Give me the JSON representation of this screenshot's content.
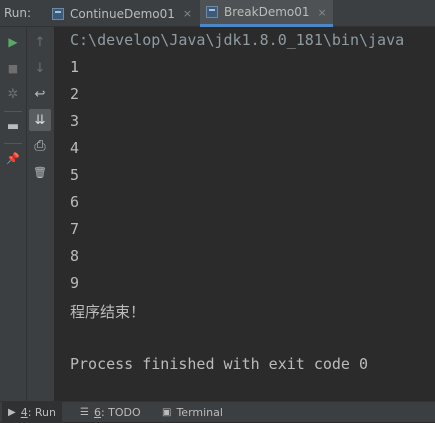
{
  "header": {
    "run_label": "Run:",
    "tabs": [
      {
        "label": "ContinueDemo01",
        "active": false
      },
      {
        "label": "BreakDemo01",
        "active": true
      }
    ],
    "close_glyph": "×"
  },
  "toolbar": {
    "left": [
      {
        "icon": "play-icon",
        "glyph": "▶",
        "color": "#59a869"
      },
      {
        "icon": "stop-icon",
        "glyph": "■",
        "color": "#6e6e6e"
      },
      {
        "icon": "debug-icon",
        "glyph": "✲",
        "color": "#6e6e6e"
      },
      {
        "icon": "layout-icon",
        "glyph": "▬",
        "color": "#bbbbbb"
      },
      {
        "icon": "pin-icon",
        "glyph": "📌",
        "color": "#bbbbbb"
      }
    ],
    "right": [
      {
        "icon": "arrow-up-icon",
        "glyph": "↑"
      },
      {
        "icon": "arrow-down-icon",
        "glyph": "↓"
      },
      {
        "icon": "soft-wrap-icon",
        "glyph": "↩"
      },
      {
        "icon": "scroll-to-end-icon",
        "glyph": "⇊"
      },
      {
        "icon": "print-icon",
        "glyph": "⎙"
      },
      {
        "icon": "trash-icon",
        "glyph": "🗑"
      }
    ]
  },
  "console": {
    "command": "C:\\develop\\Java\\jdk1.8.0_181\\bin\\java",
    "output": [
      "1",
      "2",
      "3",
      "4",
      "5",
      "6",
      "7",
      "8",
      "9",
      "程序结束！"
    ],
    "exit_message": "Process finished with exit code 0"
  },
  "statusbar": {
    "tabs": [
      {
        "icon": "play-icon",
        "glyph": "▶",
        "mnemonic": "4",
        "label": ": Run"
      },
      {
        "icon": "todo-icon",
        "glyph": "☰",
        "mnemonic": "6",
        "label": ": TODO"
      },
      {
        "icon": "terminal-icon",
        "glyph": "▣",
        "mnemonic": "",
        "label": "Terminal"
      }
    ]
  }
}
